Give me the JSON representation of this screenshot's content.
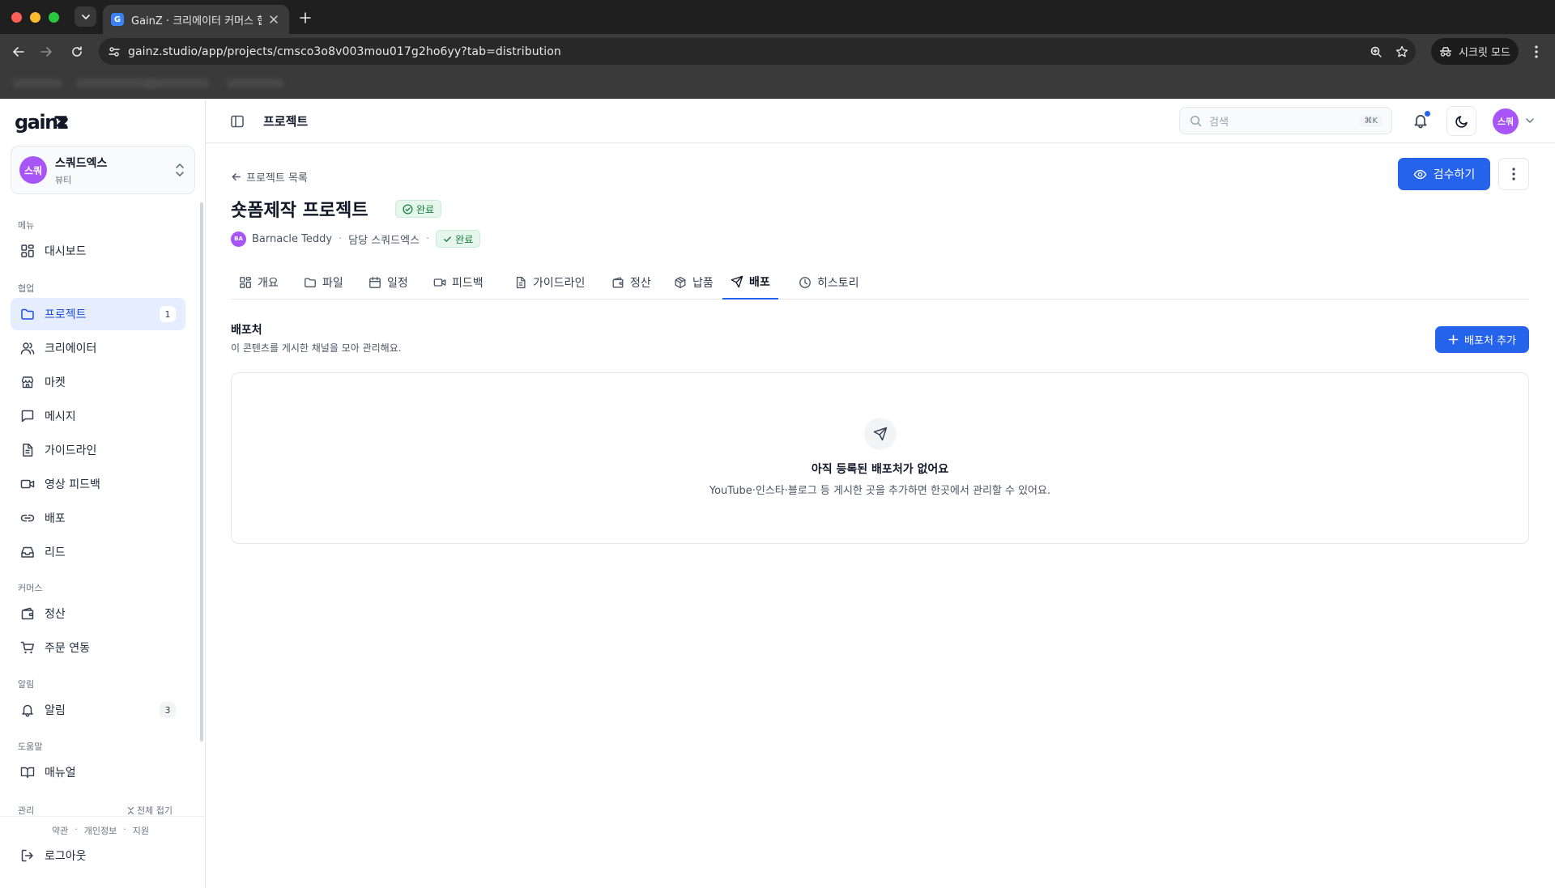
{
  "browser": {
    "tab_title": "GainZ · 크리에이터 커머스 협업 O",
    "favicon_letter": "G",
    "url": "gainz.studio/app/projects/cmsco3o8v003mou017g2ho6yy?tab=distribution",
    "incognito_label": "시크릿 모드"
  },
  "sidebar": {
    "logo": "gainz",
    "workspace": {
      "avatar": "스쿼",
      "name": "스쿼드엑스",
      "category": "뷰티"
    },
    "sections": {
      "menu": "메뉴",
      "collab": "협업",
      "commerce": "커머스",
      "alerts": "알림",
      "help": "도움말",
      "admin": "관리"
    },
    "items": {
      "dashboard": "대시보드",
      "projects": "프로젝트",
      "projects_count": "1",
      "creators": "크리에이터",
      "market": "마켓",
      "messages": "메시지",
      "guidelines": "가이드라인",
      "video_feedback": "영상 피드백",
      "distribution": "배포",
      "leads": "리드",
      "settlement": "정산",
      "order_sync": "주문 연동",
      "notifications": "알림",
      "notifications_count": "3",
      "manual": "매뉴얼"
    },
    "collapse_all": "전체 접기",
    "footer": {
      "terms": "약관",
      "privacy": "개인정보",
      "support": "지원",
      "sep": "·",
      "logout": "로그아웃"
    }
  },
  "topbar": {
    "title": "프로젝트",
    "search_placeholder": "검색",
    "search_shortcut": "⌘K",
    "user_avatar": "스쿼"
  },
  "project": {
    "back_label": "프로젝트 목록",
    "title": "숏폼제작 프로젝트",
    "status": "완료",
    "owner_initials": "BA",
    "owner": "Barnacle Teddy",
    "manager": "담당 스쿼드엑스",
    "meta_status": "완료",
    "dot": "·",
    "review_button": "검수하기"
  },
  "tabs": {
    "overview": "개요",
    "files": "파일",
    "schedule": "일정",
    "feedback": "피드백",
    "guideline": "가이드라인",
    "settlement": "정산",
    "delivery": "납품",
    "distribution": "배포",
    "history": "히스토리"
  },
  "distribution": {
    "title": "배포처",
    "subtitle": "이 콘텐츠를 게시한 채널을 모아 관리해요.",
    "add_button": "배포처 추가",
    "empty_title": "아직 등록된 배포처가 없어요",
    "empty_desc": "YouTube·인스타·블로그 등 게시한 곳을 추가하면 한곳에서 관리할 수 있어요."
  },
  "colors": {
    "accent": "#2563eb",
    "avatar": "#a855f7",
    "success": "#15803d",
    "active_nav_bg": "#e5edff"
  }
}
